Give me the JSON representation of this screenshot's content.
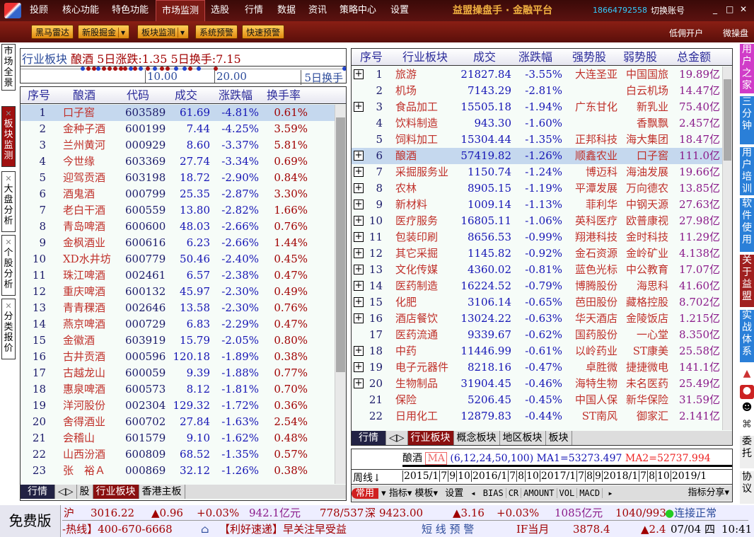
{
  "topbar": {
    "menus": [
      "投顾",
      "核心功能",
      "特色功能",
      "市场监测",
      "选股",
      "行情",
      "数据",
      "资讯",
      "策略中心",
      "设置"
    ],
    "active": "市场监测",
    "brand": "益盟操盘手 · 金融平台",
    "phone": "18664792558",
    "switch_account": "切换账号"
  },
  "toolbar": {
    "buttons": [
      "黑马雷达",
      "新股掘金",
      "板块监测",
      "系统预警",
      "快速预警"
    ],
    "links": [
      "低佣开户",
      "微操盘"
    ]
  },
  "left_tabs": [
    "市场全景",
    "板块监测",
    "大盘分析",
    "个股分析",
    "分类报价"
  ],
  "summary": {
    "sector_type": "行业板块",
    "sector": "酿酒",
    "change_label": "5日涨跌:1.35",
    "turnover_label": "5日换手:7.15",
    "scale": [
      "10.00",
      "20.00"
    ],
    "scale_unit": "5日换手"
  },
  "left_table": {
    "headers": [
      "序号",
      "酿酒",
      "代码",
      "成交",
      "涨跌幅",
      "换手率"
    ],
    "rows": [
      [
        "1",
        "口子窖",
        "603589",
        "61.69",
        "-4.81%",
        "0.61%"
      ],
      [
        "2",
        "金种子酒",
        "600199",
        "7.44",
        "-4.25%",
        "3.59%"
      ],
      [
        "3",
        "兰州黄河",
        "000929",
        "8.60",
        "-3.37%",
        "5.81%"
      ],
      [
        "4",
        "今世缘",
        "603369",
        "27.74",
        "-3.34%",
        "0.69%"
      ],
      [
        "5",
        "迎驾贡酒",
        "603198",
        "18.72",
        "-2.90%",
        "0.84%"
      ],
      [
        "6",
        "酒鬼酒",
        "000799",
        "25.35",
        "-2.87%",
        "3.30%"
      ],
      [
        "7",
        "老白干酒",
        "600559",
        "13.80",
        "-2.82%",
        "1.66%"
      ],
      [
        "8",
        "青岛啤酒",
        "600600",
        "48.03",
        "-2.66%",
        "0.76%"
      ],
      [
        "9",
        "金枫酒业",
        "600616",
        "6.23",
        "-2.66%",
        "1.44%"
      ],
      [
        "10",
        "XD水井坊",
        "600779",
        "50.46",
        "-2.40%",
        "0.45%"
      ],
      [
        "11",
        "珠江啤酒",
        "002461",
        "6.57",
        "-2.38%",
        "0.47%"
      ],
      [
        "12",
        "重庆啤酒",
        "600132",
        "45.97",
        "-2.30%",
        "0.49%"
      ],
      [
        "13",
        "青青稞酒",
        "002646",
        "13.58",
        "-2.30%",
        "0.76%"
      ],
      [
        "14",
        "燕京啤酒",
        "000729",
        "6.83",
        "-2.29%",
        "0.47%"
      ],
      [
        "15",
        "金徽酒",
        "603919",
        "15.79",
        "-2.05%",
        "0.80%"
      ],
      [
        "16",
        "古井贡酒",
        "000596",
        "120.18",
        "-1.89%",
        "0.38%"
      ],
      [
        "17",
        "古越龙山",
        "600059",
        "9.39",
        "-1.88%",
        "0.77%"
      ],
      [
        "18",
        "惠泉啤酒",
        "600573",
        "8.12",
        "-1.81%",
        "0.70%"
      ],
      [
        "19",
        "洋河股份",
        "002304",
        "129.32",
        "-1.72%",
        "0.36%"
      ],
      [
        "20",
        "舍得酒业",
        "600702",
        "27.84",
        "-1.63%",
        "2.54%"
      ],
      [
        "21",
        "会稽山",
        "601579",
        "9.10",
        "-1.62%",
        "0.48%"
      ],
      [
        "22",
        "山西汾酒",
        "600809",
        "68.52",
        "-1.35%",
        "0.57%"
      ],
      [
        "23",
        "张　裕Ａ",
        "000869",
        "32.12",
        "-1.26%",
        "0.38%"
      ]
    ]
  },
  "left_tabs_bottom": [
    "行情",
    "股",
    "行业板块",
    "香港主板"
  ],
  "right_table": {
    "headers": [
      "序号",
      "行业板块",
      "成交",
      "涨跌幅",
      "强势股",
      "弱势股",
      "总金额"
    ],
    "rows": [
      [
        "1",
        "旅游",
        "21827.84",
        "-3.55%",
        "大连圣亚",
        "中国国旅",
        "19.89亿",
        true
      ],
      [
        "2",
        "机场",
        "7143.29",
        "-2.81%",
        "",
        "白云机场",
        "14.47亿",
        false
      ],
      [
        "3",
        "食品加工",
        "15505.18",
        "-1.94%",
        "广东甘化",
        "新乳业",
        "75.40亿",
        true
      ],
      [
        "4",
        "饮料制造",
        "943.30",
        "-1.60%",
        "",
        "香飘飘",
        "2.457亿",
        false
      ],
      [
        "5",
        "饲料加工",
        "15304.44",
        "-1.35%",
        "正邦科技",
        "海大集团",
        "18.47亿",
        false
      ],
      [
        "6",
        "酿酒",
        "57419.82",
        "-1.26%",
        "顺鑫农业",
        "口子窖",
        "111.0亿",
        true
      ],
      [
        "7",
        "采掘服务业",
        "1150.74",
        "-1.24%",
        "博迈科",
        "海油发展",
        "19.66亿",
        true
      ],
      [
        "8",
        "农林",
        "8905.15",
        "-1.19%",
        "平潭发展",
        "万向德农",
        "13.85亿",
        true
      ],
      [
        "9",
        "新材料",
        "1009.14",
        "-1.13%",
        "菲利华",
        "中钢天源",
        "27.63亿",
        true
      ],
      [
        "10",
        "医疗服务",
        "16805.11",
        "-1.06%",
        "英科医疗",
        "欧普康视",
        "27.98亿",
        true
      ],
      [
        "11",
        "包装印刷",
        "8656.53",
        "-0.99%",
        "翔港科技",
        "金时科技",
        "11.29亿",
        true
      ],
      [
        "12",
        "其它采掘",
        "1145.82",
        "-0.92%",
        "金石资源",
        "金岭矿业",
        "4.138亿",
        true
      ],
      [
        "13",
        "文化传媒",
        "4360.02",
        "-0.81%",
        "蓝色光标",
        "中公教育",
        "17.07亿",
        true
      ],
      [
        "14",
        "医药制造",
        "16224.52",
        "-0.79%",
        "博腾股份",
        "海思科",
        "41.60亿",
        true
      ],
      [
        "15",
        "化肥",
        "3106.14",
        "-0.65%",
        "芭田股份",
        "藏格控股",
        "8.702亿",
        true
      ],
      [
        "16",
        "酒店餐饮",
        "13024.22",
        "-0.63%",
        "华天酒店",
        "金陵饭店",
        "1.215亿",
        true
      ],
      [
        "17",
        "医药流通",
        "9339.67",
        "-0.62%",
        "国药股份",
        "一心堂",
        "8.350亿",
        false
      ],
      [
        "18",
        "中药",
        "11446.99",
        "-0.61%",
        "以岭药业",
        "ST康美",
        "25.58亿",
        true
      ],
      [
        "19",
        "电子元器件",
        "8218.16",
        "-0.47%",
        "卓胜微",
        "捷捷微电",
        "141.1亿",
        true
      ],
      [
        "20",
        "生物制品",
        "31904.45",
        "-0.46%",
        "海特生物",
        "未名医药",
        "25.49亿",
        true
      ],
      [
        "21",
        "保险",
        "5206.45",
        "-0.45%",
        "中国人保",
        "新华保险",
        "31.59亿",
        false
      ],
      [
        "22",
        "日用化工",
        "12879.83",
        "-0.44%",
        "ST南风",
        "御家汇",
        "2.141亿",
        false
      ]
    ]
  },
  "right_tabs_bottom": [
    "行情",
    "行业板块",
    "概念板块",
    "地区板块",
    "板块"
  ],
  "chart": {
    "name": "酿酒",
    "ma_btn": "MA",
    "ma_params": "(6,12,24,50,100)",
    "ma1": "MA1=53273.497",
    "ma2": "MA2=52737.994",
    "period": "周线",
    "dates": [
      "2015/1",
      "7",
      "9",
      "10",
      "2016/1",
      "7",
      "8",
      "10",
      "2017/1",
      "7",
      "8",
      "9",
      "2018/1",
      "7",
      "8",
      "10",
      "2019/1"
    ],
    "toolbar": [
      "常用",
      "指标",
      "模板",
      "设置"
    ],
    "indicators": [
      "BIAS",
      "CR",
      "AMOUNT",
      "VOL",
      "MACD"
    ],
    "share": "指标分享"
  },
  "right_sidebar": [
    "用户之家",
    "三分钟",
    "用户培训",
    "软件使用",
    "关于益盟",
    "实战体系",
    "委托",
    "协议"
  ],
  "right_sidebar_colors": [
    "#d03cc8",
    "#2a7fd8",
    "#2a7fd8",
    "#2a7fd8",
    "#a02020",
    "#2a7fd8"
  ],
  "status": {
    "edition": "免费版",
    "sh": {
      "label": "沪",
      "index": "3016.22",
      "chg": "▲0.96",
      "pct": "+0.03%",
      "amount": "942.1亿元",
      "updown": "778/537"
    },
    "sz": {
      "label": "深",
      "index": "9423.00",
      "chg": "▲3.16",
      "pct": "+0.03%",
      "amount": "1085亿元",
      "updown": "1040/993"
    },
    "connection": "连接正常",
    "hotline": "-热线】400-670-6668",
    "news": "【利好速递】早关注早受益",
    "alert": "短 线 预 警",
    "futures": "IF当月",
    "fut_price": "3878.4",
    "fut_chg": "▲2.4",
    "date": "07/04 四",
    "time": "10:41"
  }
}
